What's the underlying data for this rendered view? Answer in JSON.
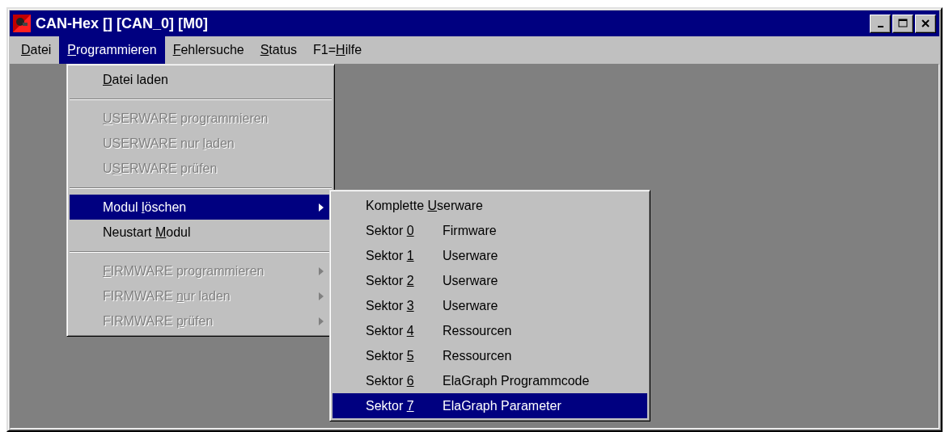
{
  "window": {
    "title": "CAN-Hex [] [CAN_0] [M0]"
  },
  "menu_bar": [
    {
      "key": "D",
      "after": "atei",
      "selected": false
    },
    {
      "key": "P",
      "after": "rogrammieren",
      "selected": true
    },
    {
      "key": "F",
      "after": "ehlersuche",
      "selected": false
    },
    {
      "key": "S",
      "after": "tatus",
      "selected": false
    },
    {
      "before": "F1=",
      "key": "H",
      "after": "ilfe",
      "selected": false
    }
  ],
  "dropdown": [
    {
      "kind": "item",
      "key": "D",
      "after": "atei laden",
      "disabled": false,
      "selected": false,
      "submenu": false
    },
    {
      "kind": "separator"
    },
    {
      "kind": "item",
      "key": "U",
      "after": "SERWARE programmieren",
      "disabled": true,
      "selected": false,
      "submenu": false
    },
    {
      "kind": "item",
      "before": "USERWARE nur ",
      "key": "l",
      "after": "aden",
      "disabled": true,
      "selected": false,
      "submenu": false
    },
    {
      "kind": "item",
      "before": "U",
      "key": "S",
      "after": "ERWARE prüfen",
      "disabled": true,
      "selected": false,
      "submenu": false
    },
    {
      "kind": "separator"
    },
    {
      "kind": "item",
      "before": "Modul ",
      "key": "l",
      "after": "öschen",
      "disabled": false,
      "selected": true,
      "submenu": true
    },
    {
      "kind": "item",
      "before": "Neustart ",
      "key": "M",
      "after": "odul",
      "disabled": false,
      "selected": false,
      "submenu": false
    },
    {
      "kind": "separator"
    },
    {
      "kind": "item",
      "key": "F",
      "after": "IRMWARE programmieren",
      "disabled": true,
      "selected": false,
      "submenu": true
    },
    {
      "kind": "item",
      "before": "FIRMWARE ",
      "key": "n",
      "after": "ur laden",
      "disabled": true,
      "selected": false,
      "submenu": true
    },
    {
      "kind": "item",
      "before": "FIRMWARE ",
      "key": "p",
      "after": "rüfen",
      "disabled": true,
      "selected": false,
      "submenu": true
    }
  ],
  "submenu": [
    {
      "before": "Komplette ",
      "key": "U",
      "after": "serware",
      "selected": false
    },
    {
      "before": "Sektor ",
      "key": "0",
      "detail": "Firmware",
      "selected": false
    },
    {
      "before": "Sektor ",
      "key": "1",
      "detail": "Userware",
      "selected": false
    },
    {
      "before": "Sektor ",
      "key": "2",
      "detail": "Userware",
      "selected": false
    },
    {
      "before": "Sektor ",
      "key": "3",
      "detail": "Userware",
      "selected": false
    },
    {
      "before": "Sektor ",
      "key": "4",
      "detail": "Ressourcen",
      "selected": false
    },
    {
      "before": "Sektor ",
      "key": "5",
      "detail": "Ressourcen",
      "selected": false
    },
    {
      "before": "Sektor ",
      "key": "6",
      "detail": "ElaGraph Programmcode",
      "selected": false
    },
    {
      "before": "Sektor ",
      "key": "7",
      "detail": "ElaGraph Parameter",
      "selected": true
    }
  ]
}
